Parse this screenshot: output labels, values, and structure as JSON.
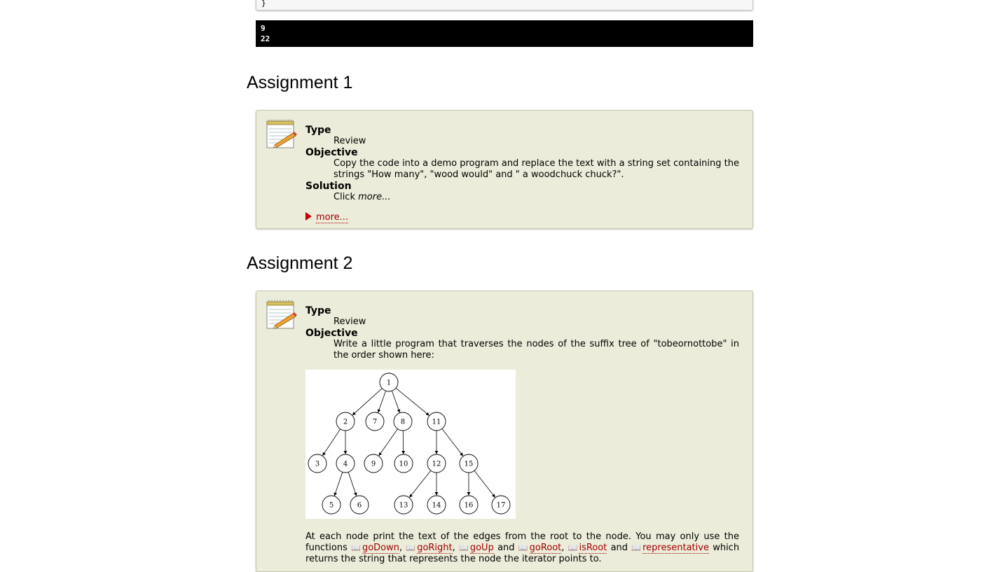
{
  "code_tail": {
    "text": "}"
  },
  "output": {
    "lines": [
      "9",
      "22"
    ]
  },
  "assignments": [
    {
      "heading": "Assignment 1",
      "type_label": "Type",
      "type_value": "Review",
      "objective_label": "Objective",
      "objective_text": "Copy the code into a demo program and replace the text with a string set containing the strings \"How many\", \"wood would\" and \" a woodchuck chuck?\".",
      "solution_label": "Solution",
      "solution_prefix": "Click ",
      "solution_more": "more...",
      "more_link": "more..."
    },
    {
      "heading": "Assignment 2",
      "type_label": "Type",
      "type_value": "Review",
      "objective_label": "Objective",
      "objective_text": "Write a little program that traverses the nodes of the suffix tree of \"tobeornottobe\" in the order shown here:",
      "para_start": "At each node print the text of the edges from the root to the node. You may only use the functions ",
      "functions": [
        "goDown",
        "goRight",
        "goUp",
        "goRoot",
        "isRoot",
        "representative"
      ],
      "sep_comma": ",",
      "sep_and": "and",
      "para_end": "which returns the string that represents the node the iterator points to."
    }
  ],
  "tree": {
    "nodes": [
      "1",
      "2",
      "3",
      "4",
      "5",
      "6",
      "7",
      "8",
      "9",
      "10",
      "11",
      "12",
      "13",
      "14",
      "15",
      "16",
      "17"
    ],
    "edges": [
      [
        "1",
        "2"
      ],
      [
        "1",
        "7"
      ],
      [
        "1",
        "8"
      ],
      [
        "1",
        "11"
      ],
      [
        "2",
        "3"
      ],
      [
        "2",
        "4"
      ],
      [
        "4",
        "5"
      ],
      [
        "4",
        "6"
      ],
      [
        "8",
        "9"
      ],
      [
        "8",
        "10"
      ],
      [
        "11",
        "12"
      ],
      [
        "11",
        "15"
      ],
      [
        "12",
        "13"
      ],
      [
        "12",
        "14"
      ],
      [
        "15",
        "16"
      ],
      [
        "15",
        "17"
      ]
    ]
  },
  "icons": {
    "assignment": "notepad-pencil-icon",
    "reference": "book-icon",
    "expand": "triangle-right-icon"
  },
  "colors": {
    "box_bg": "#ececda",
    "link": "#a00000",
    "output_bg": "#000000"
  }
}
